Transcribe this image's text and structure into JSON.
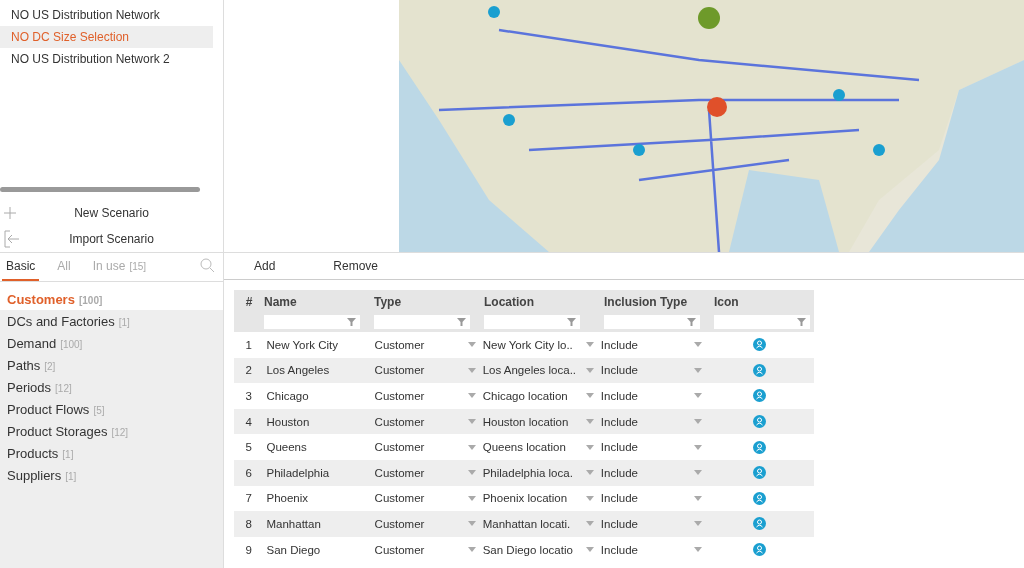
{
  "scenarios": [
    {
      "label": "NO US Distribution Network",
      "selected": false
    },
    {
      "label": "NO DC Size Selection",
      "selected": true
    },
    {
      "label": "NO US Distribution Network 2",
      "selected": false
    }
  ],
  "scenario_actions": [
    {
      "label": "New Scenario",
      "kind": "new"
    },
    {
      "label": "Import Scenario",
      "kind": "import"
    }
  ],
  "map": {
    "kind": "picture"
  },
  "tabs": [
    {
      "label": "Basic",
      "selected": true
    },
    {
      "label": "All",
      "selected": false
    },
    {
      "label": "In use",
      "count": "[15]",
      "selected": false
    }
  ],
  "categories": [
    {
      "label": "Customers",
      "count": "[100]",
      "selected": true
    },
    {
      "label": "DCs and Factories",
      "count": "[1]",
      "selected": false
    },
    {
      "label": "Demand",
      "count": "[100]",
      "selected": false
    },
    {
      "label": "Paths",
      "count": "[2]",
      "selected": false
    },
    {
      "label": "Periods",
      "count": "[12]",
      "selected": false
    },
    {
      "label": "Product Flows",
      "count": "[5]",
      "selected": false
    },
    {
      "label": "Product Storages",
      "count": "[12]",
      "selected": false
    },
    {
      "label": "Products",
      "count": "[1]",
      "selected": false
    },
    {
      "label": "Suppliers",
      "count": "[1]",
      "selected": false
    }
  ],
  "toolbar": [
    "Add",
    "Remove"
  ],
  "table": {
    "columns": [
      "#",
      "Name",
      "Type",
      "Location",
      "Inclusion Type",
      "Icon"
    ],
    "rows": [
      [
        "1",
        "New York City",
        "Customer",
        "New York City lo..",
        "Include"
      ],
      [
        "2",
        "Los Angeles",
        "Customer",
        "Los Angeles loca..",
        "Include"
      ],
      [
        "3",
        "Chicago",
        "Customer",
        "Chicago location",
        "Include"
      ],
      [
        "4",
        "Houston",
        "Customer",
        "Houston location",
        "Include"
      ],
      [
        "5",
        "Queens",
        "Customer",
        "Queens location",
        "Include"
      ],
      [
        "6",
        "Philadelphia",
        "Customer",
        "Philadelphia loca.",
        "Include"
      ],
      [
        "7",
        "Phoenix",
        "Customer",
        "Phoenix location",
        "Include"
      ],
      [
        "8",
        "Manhattan",
        "Customer",
        "Manhattan locati.",
        "Include"
      ],
      [
        "9",
        "San Diego",
        "Customer",
        "San Diego locatio",
        "Include"
      ]
    ]
  }
}
